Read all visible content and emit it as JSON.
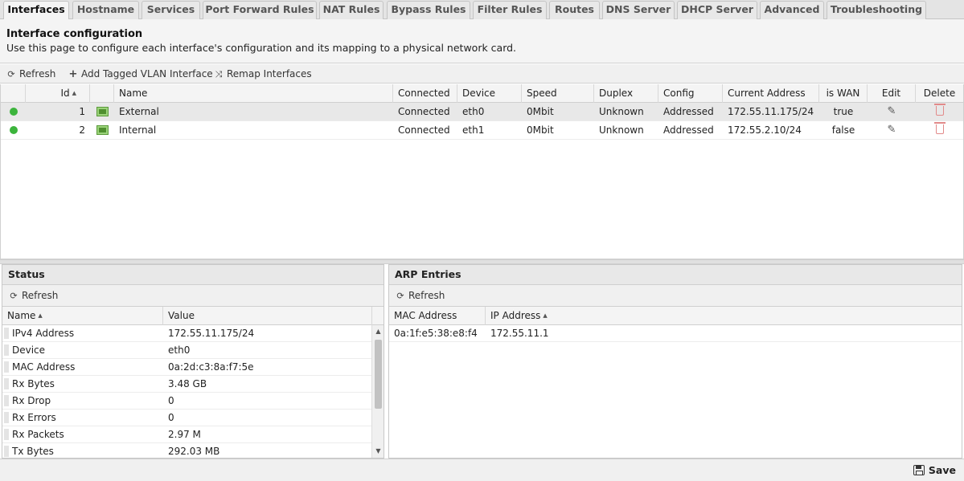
{
  "tabs": [
    {
      "label": "Interfaces",
      "active": true
    },
    {
      "label": "Hostname"
    },
    {
      "label": "Services"
    },
    {
      "label": "Port Forward Rules"
    },
    {
      "label": "NAT Rules"
    },
    {
      "label": "Bypass Rules"
    },
    {
      "label": "Filter Rules"
    },
    {
      "label": "Routes"
    },
    {
      "label": "DNS Server"
    },
    {
      "label": "DHCP Server"
    },
    {
      "label": "Advanced"
    },
    {
      "label": "Troubleshooting"
    }
  ],
  "intro": {
    "title": "Interface configuration",
    "description": "Use this page to configure each interface's configuration and its mapping to a physical network card."
  },
  "toolbar": {
    "refresh": "Refresh",
    "add_vlan": "Add Tagged VLAN Interface",
    "remap": "Remap Interfaces"
  },
  "grid": {
    "headers": {
      "id": "Id",
      "name": "Name",
      "connected": "Connected",
      "device": "Device",
      "speed": "Speed",
      "duplex": "Duplex",
      "config": "Config",
      "current_address": "Current Address",
      "is_wan": "is WAN",
      "edit": "Edit",
      "delete": "Delete"
    },
    "rows": [
      {
        "id": "1",
        "name": "External",
        "connected": "Connected",
        "device": "eth0",
        "speed": "0Mbit",
        "duplex": "Unknown",
        "config": "Addressed",
        "current_address": "172.55.11.175/24",
        "is_wan": "true"
      },
      {
        "id": "2",
        "name": "Internal",
        "connected": "Connected",
        "device": "eth1",
        "speed": "0Mbit",
        "duplex": "Unknown",
        "config": "Addressed",
        "current_address": "172.55.2.10/24",
        "is_wan": "false"
      }
    ],
    "status_color": "#3cb43c"
  },
  "status_panel": {
    "title": "Status",
    "refresh": "Refresh",
    "headers": {
      "name": "Name",
      "value": "Value"
    },
    "rows": [
      {
        "name": "IPv4 Address",
        "value": "172.55.11.175/24"
      },
      {
        "name": "Device",
        "value": "eth0"
      },
      {
        "name": "MAC Address",
        "value": "0a:2d:c3:8a:f7:5e"
      },
      {
        "name": "Rx Bytes",
        "value": "3.48 GB"
      },
      {
        "name": "Rx Drop",
        "value": "0"
      },
      {
        "name": "Rx Errors",
        "value": "0"
      },
      {
        "name": "Rx Packets",
        "value": "2.97 M"
      },
      {
        "name": "Tx Bytes",
        "value": "292.03 MB"
      }
    ]
  },
  "arp_panel": {
    "title": "ARP Entries",
    "refresh": "Refresh",
    "headers": {
      "mac": "MAC Address",
      "ip": "IP Address"
    },
    "rows": [
      {
        "mac": "0a:1f:e5:38:e8:f4",
        "ip": "172.55.11.1"
      }
    ]
  },
  "footer": {
    "save": "Save"
  }
}
